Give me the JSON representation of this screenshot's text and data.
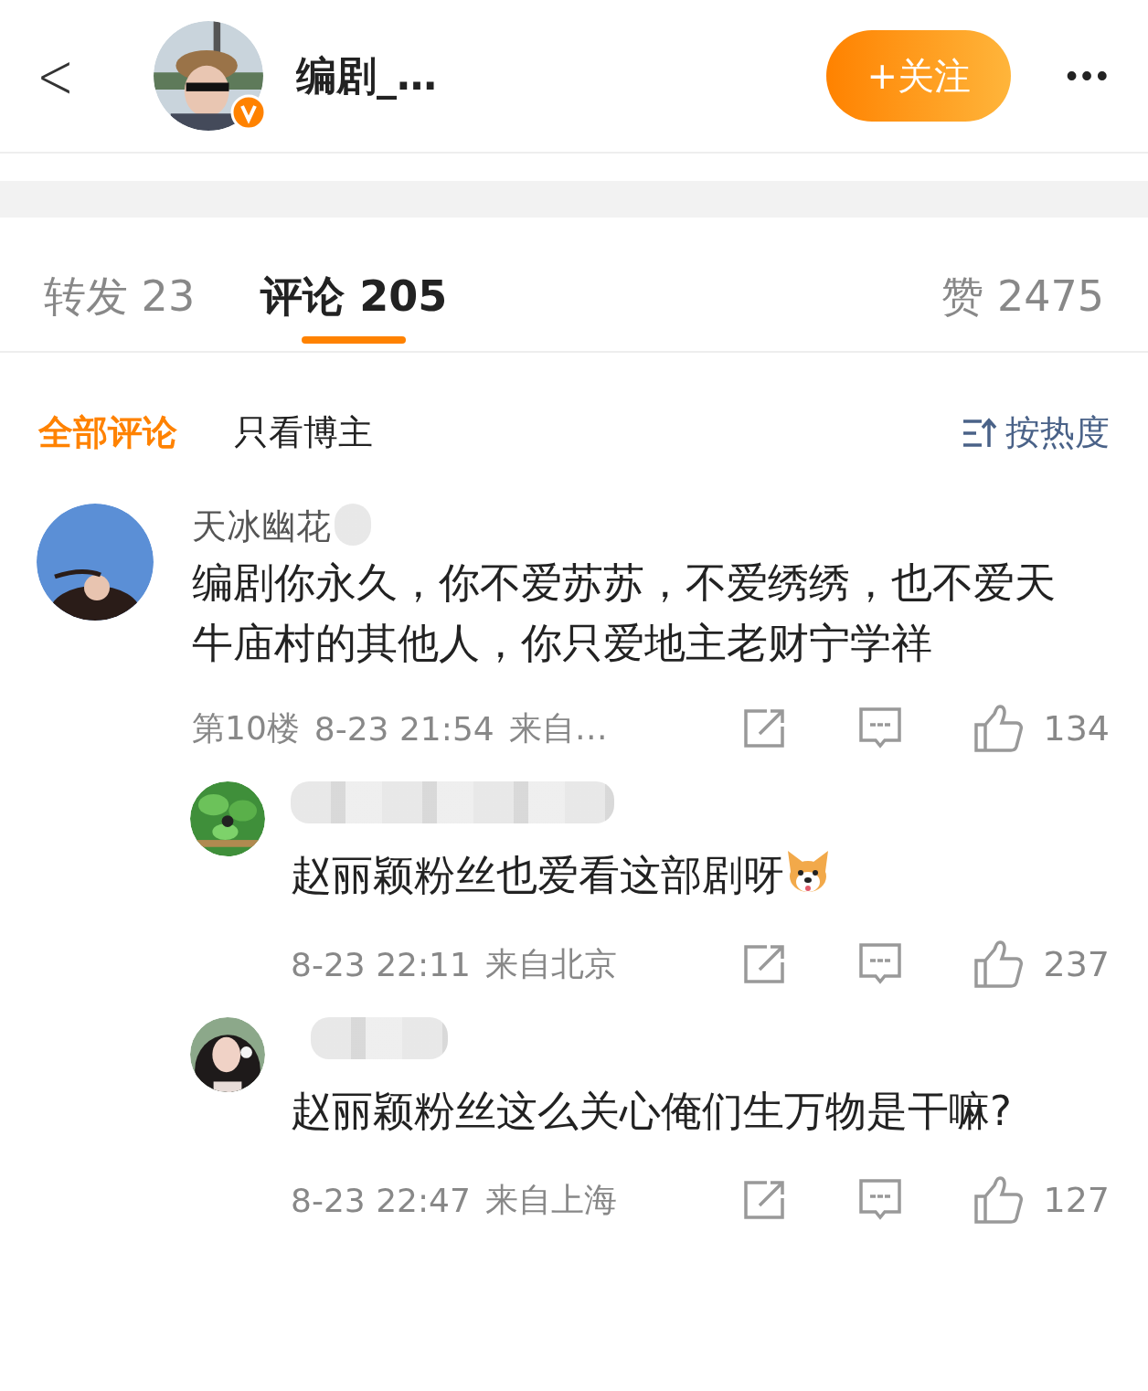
{
  "header": {
    "back": "<",
    "name": "编剧_…",
    "verified": true,
    "follow_button": "+关注",
    "more": "•••"
  },
  "tabs": [
    {
      "label": "转发 23",
      "selected": false
    },
    {
      "label": "评论 205",
      "selected": true
    },
    {
      "label": "赞 2475",
      "selected": false
    }
  ],
  "filters": [
    {
      "label": "全部评论",
      "selected": true
    },
    {
      "label": "只看博主",
      "selected": false
    }
  ],
  "sort": {
    "label": "按热度"
  },
  "comments": [
    {
      "name": "天冰幽花",
      "name_blurred": true,
      "text": "编剧你永久，你不爱苏苏，不爱绣绣，也不爱天牛庙村的其他人，你只爱地主老财宁学祥",
      "floor": "第10楼",
      "time": "8-23 21:54",
      "source": "来自…",
      "likes": "134",
      "replies": [
        {
          "name_blurred": true,
          "text": "赵丽颖粉丝也爱看这部剧呀",
          "emoji": true,
          "time": "8-23 22:11",
          "source": "来自北京",
          "likes": "237"
        },
        {
          "name_blurred": true,
          "text": "赵丽颖粉丝这么关心俺们生万物是干嘛?",
          "time": "8-23 22:47",
          "source": "来自上海",
          "likes": "127"
        }
      ]
    }
  ]
}
